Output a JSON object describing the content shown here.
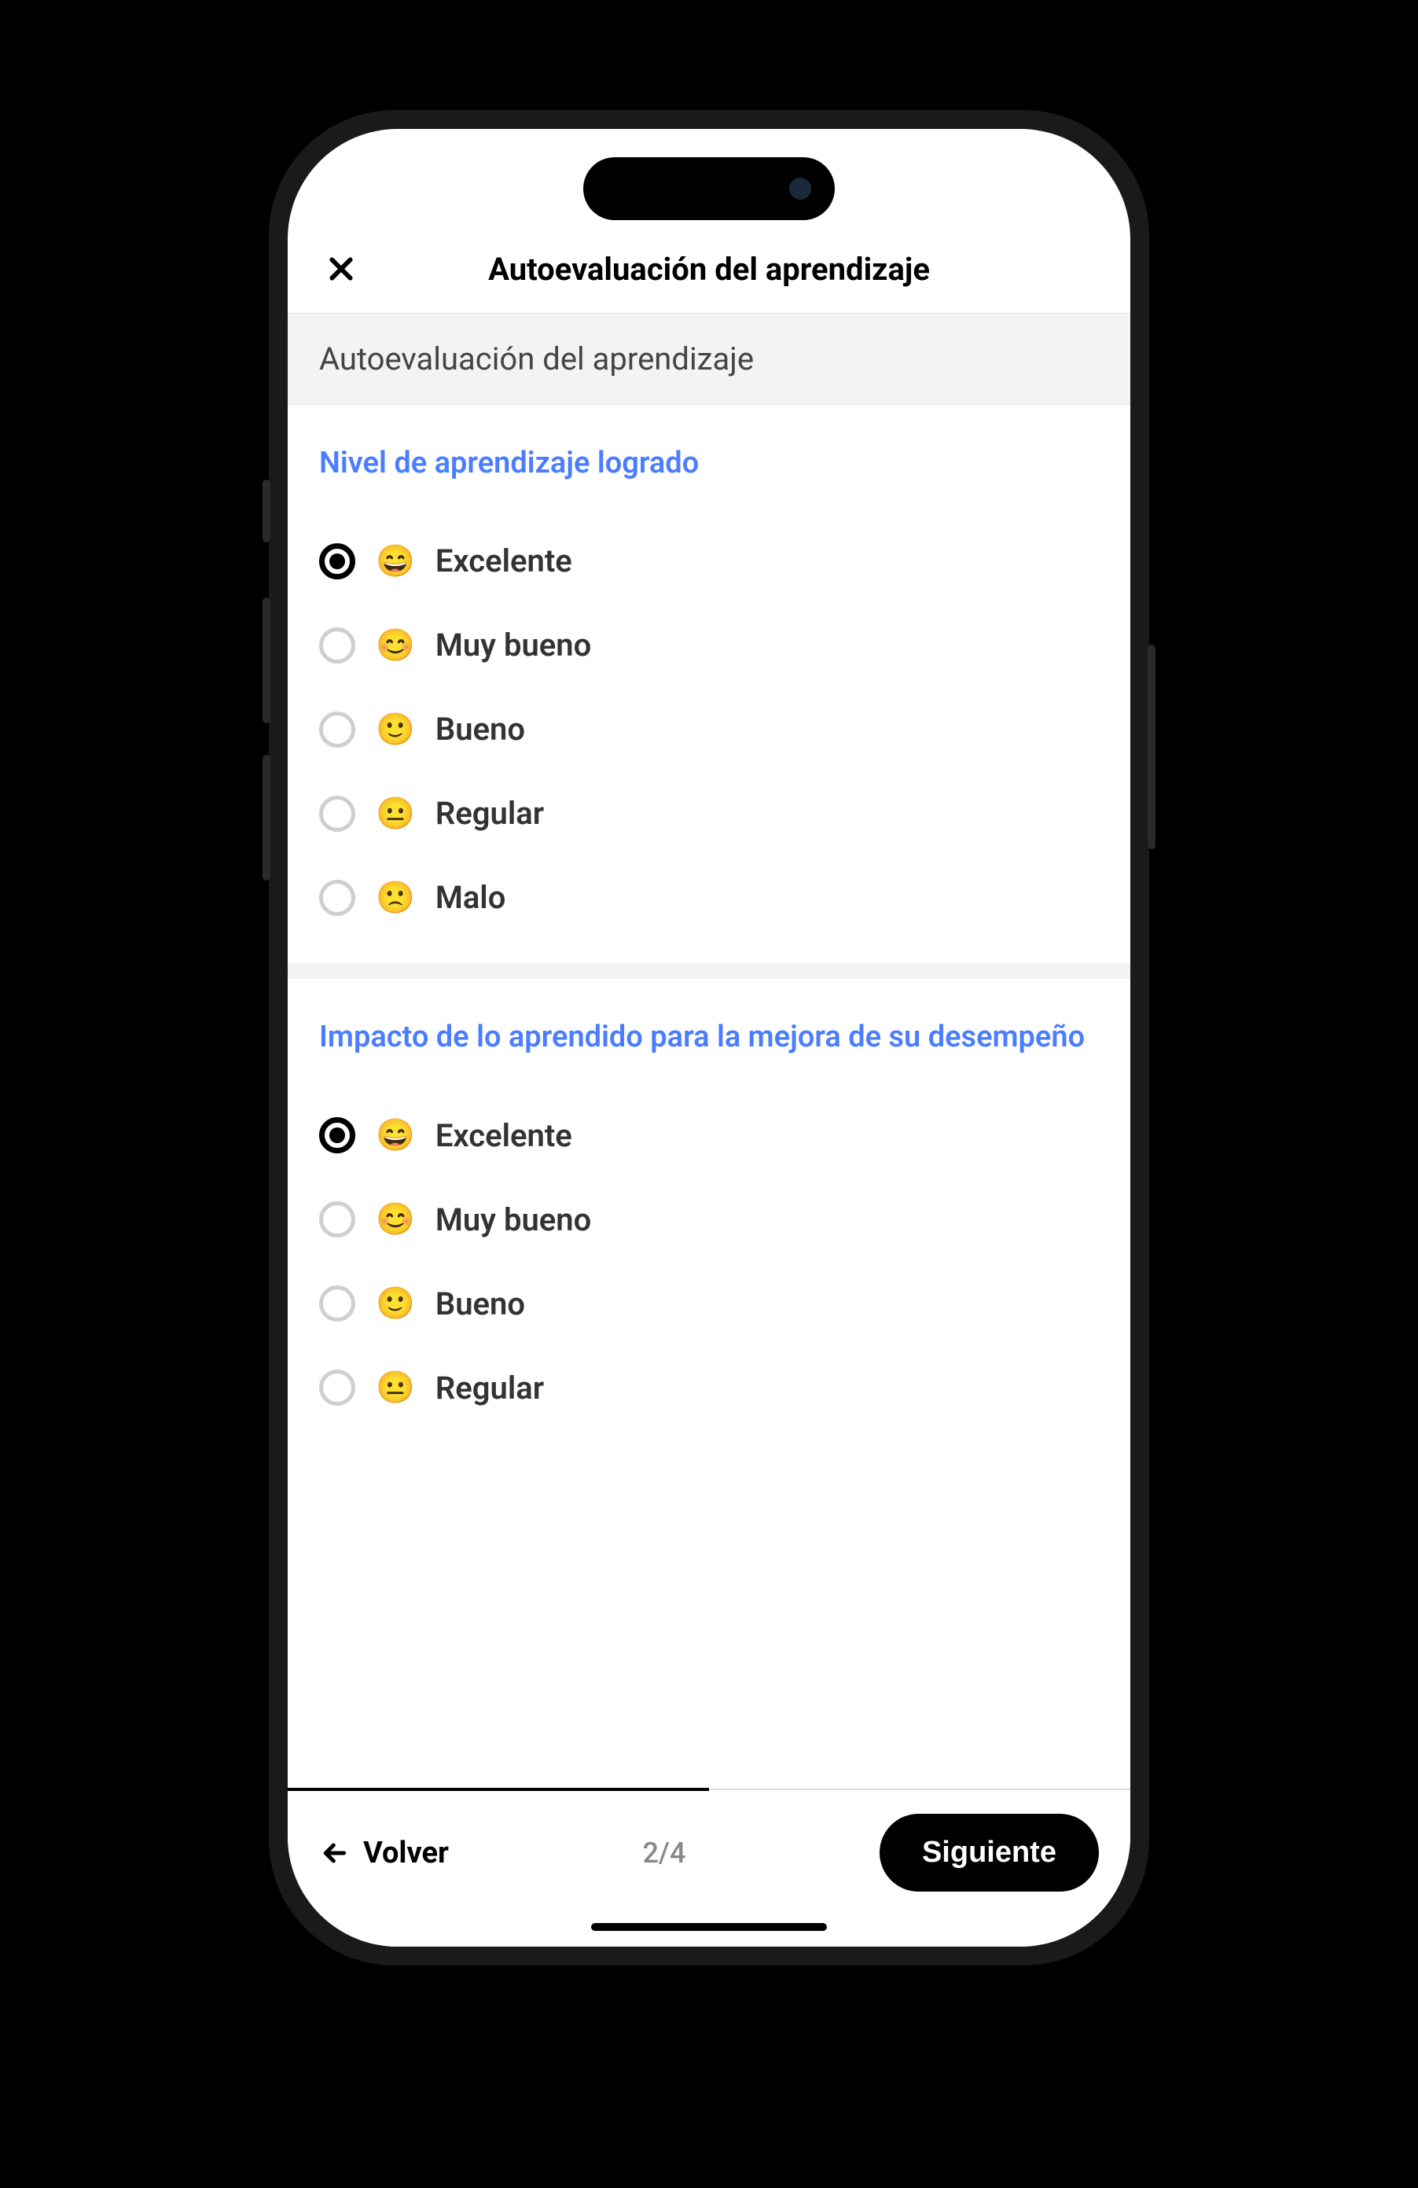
{
  "header": {
    "title": "Autoevaluación del aprendizaje"
  },
  "subheader": "Autoevaluación del aprendizaje",
  "sections": [
    {
      "title": "Nivel de aprendizaje logrado",
      "options": [
        {
          "emoji": "😄",
          "label": "Excelente",
          "selected": true
        },
        {
          "emoji": "😊",
          "label": "Muy bueno",
          "selected": false
        },
        {
          "emoji": "🙂",
          "label": "Bueno",
          "selected": false
        },
        {
          "emoji": "😐",
          "label": "Regular",
          "selected": false
        },
        {
          "emoji": "🙁",
          "label": "Malo",
          "selected": false
        }
      ]
    },
    {
      "title": "Impacto de lo aprendido para la mejora de su desempeño",
      "options": [
        {
          "emoji": "😄",
          "label": "Excelente",
          "selected": true
        },
        {
          "emoji": "😊",
          "label": "Muy bueno",
          "selected": false
        },
        {
          "emoji": "🙂",
          "label": "Bueno",
          "selected": false
        },
        {
          "emoji": "😐",
          "label": "Regular",
          "selected": false
        }
      ]
    }
  ],
  "footer": {
    "back": "Volver",
    "page": "2/4",
    "next": "Siguiente"
  }
}
